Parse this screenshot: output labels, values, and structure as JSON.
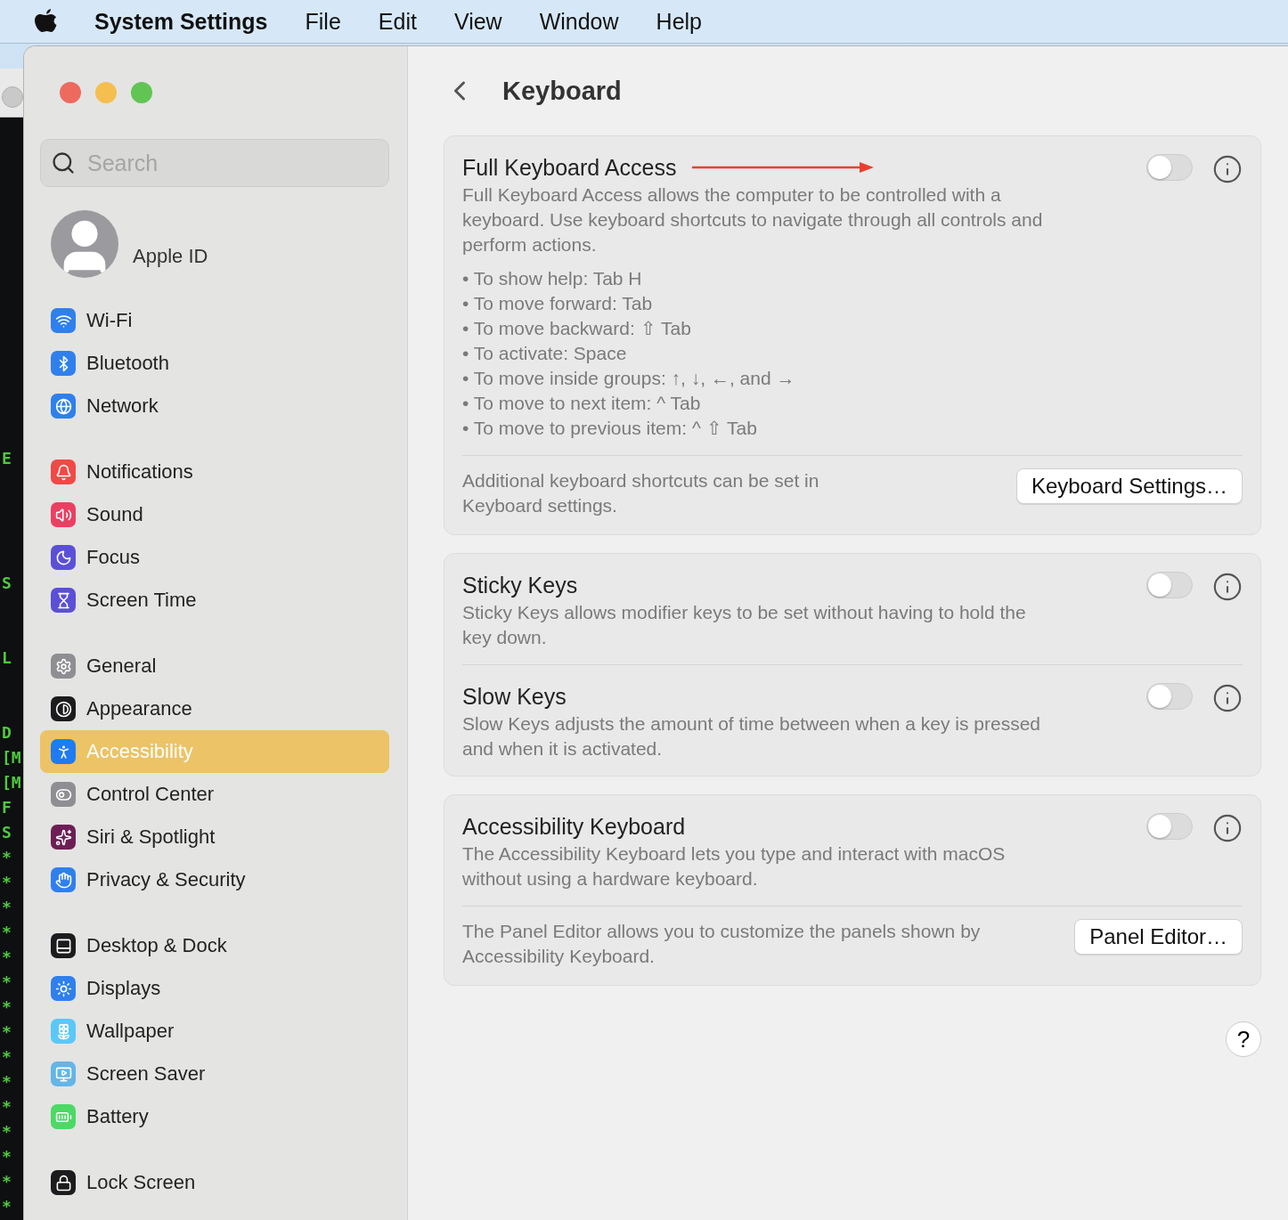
{
  "menu_bar": {
    "app_name": "System Settings",
    "items": [
      "File",
      "Edit",
      "View",
      "Window",
      "Help"
    ]
  },
  "terminal": {
    "lines": [
      "E",
      "S",
      "L",
      "D",
      "[M",
      "[M",
      "F",
      "S",
      "*",
      "*",
      "*",
      "*",
      "*",
      "*",
      "*",
      "*",
      "*",
      "*",
      "*",
      "*",
      "*",
      "*",
      "*"
    ]
  },
  "window": {
    "traffic_lights": [
      {
        "color": "#ed6a5e"
      },
      {
        "color": "#f5bf4f"
      },
      {
        "color": "#61c554"
      }
    ]
  },
  "sidebar": {
    "search": {
      "placeholder": "Search"
    },
    "account": {
      "label": "Apple ID"
    },
    "groups": [
      [
        {
          "label": "Wi-Fi",
          "color": "#2f80ed",
          "selected": false
        },
        {
          "label": "Bluetooth",
          "color": "#2f80ed",
          "selected": false
        },
        {
          "label": "Network",
          "color": "#2f80ed",
          "selected": false
        }
      ],
      [
        {
          "label": "Notifications",
          "color": "#ef4a45",
          "selected": false
        },
        {
          "label": "Sound",
          "color": "#ea3f62",
          "selected": false
        },
        {
          "label": "Focus",
          "color": "#5b4fd8",
          "selected": false
        },
        {
          "label": "Screen Time",
          "color": "#5b4fd8",
          "selected": false
        }
      ],
      [
        {
          "label": "General",
          "color": "#8e8e93",
          "selected": false
        },
        {
          "label": "Appearance",
          "color": "#1c1c1e",
          "selected": false
        },
        {
          "label": "Accessibility",
          "color": "#1f7bf2",
          "selected": true
        },
        {
          "label": "Control Center",
          "color": "#8e8e93",
          "selected": false
        },
        {
          "label": "Siri & Spotlight",
          "color": "#6d1f55",
          "selected": false
        },
        {
          "label": "Privacy & Security",
          "color": "#2f80ed",
          "selected": false
        }
      ],
      [
        {
          "label": "Desktop & Dock",
          "color": "#1c1c1e",
          "selected": false
        },
        {
          "label": "Displays",
          "color": "#2f80ed",
          "selected": false
        },
        {
          "label": "Wallpaper",
          "color": "#5ac8fa",
          "selected": false
        },
        {
          "label": "Screen Saver",
          "color": "#64b5e8",
          "selected": false
        },
        {
          "label": "Battery",
          "color": "#4cd964",
          "selected": false
        }
      ],
      [
        {
          "label": "Lock Screen",
          "color": "#1c1c1e",
          "selected": false
        }
      ]
    ]
  },
  "content": {
    "title": "Keyboard",
    "cards": [
      {
        "rows": [
          {
            "kind": "toggle",
            "title": "Full Keyboard Access",
            "on": false,
            "arrow": true,
            "description": "Full Keyboard Access allows the computer to be controlled with a keyboard. Use keyboard shortcuts to navigate through all controls and perform actions.",
            "bullets": [
              "• To show help: Tab H",
              "• To move forward: Tab",
              "• To move backward: ⇧ Tab",
              "• To activate: Space",
              "• To move inside groups: ↑, ↓, ←, and →",
              "• To move to next item: ^ Tab",
              "• To move to previous item: ^ ⇧ Tab"
            ]
          },
          {
            "kind": "footer",
            "text": "Additional keyboard shortcuts can be set in Keyboard settings.",
            "button": "Keyboard Settings…"
          }
        ]
      },
      {
        "rows": [
          {
            "kind": "toggle",
            "title": "Sticky Keys",
            "on": false,
            "arrow": false,
            "description": "Sticky Keys allows modifier keys to be set without having to hold the key down."
          },
          {
            "kind": "toggle",
            "title": "Slow Keys",
            "on": false,
            "arrow": false,
            "description": "Slow Keys adjusts the amount of time between when a key is pressed and when it is activated."
          }
        ]
      },
      {
        "rows": [
          {
            "kind": "toggle",
            "title": "Accessibility Keyboard",
            "on": false,
            "arrow": false,
            "description": "The Accessibility Keyboard lets you type and interact with macOS without using a hardware keyboard."
          },
          {
            "kind": "footer",
            "text": "The Panel Editor allows you to customize the panels shown by Accessibility Keyboard.",
            "button": "Panel Editor…"
          }
        ]
      }
    ],
    "help_button": "?"
  }
}
